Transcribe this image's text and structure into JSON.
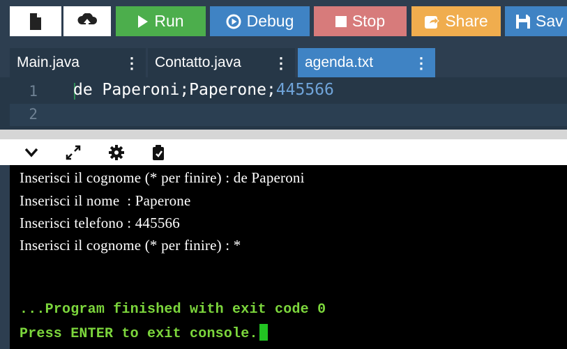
{
  "toolbar": {
    "run_label": "Run",
    "debug_label": "Debug",
    "stop_label": "Stop",
    "share_label": "Share",
    "save_label": "Sav"
  },
  "tabs": [
    {
      "label": "Main.java",
      "active": false
    },
    {
      "label": "Contatto.java",
      "active": false
    },
    {
      "label": "agenda.txt",
      "active": true
    }
  ],
  "editor": {
    "lines": [
      {
        "number": "1",
        "text": "de Paperoni;Paperone;",
        "num_text": "445566"
      },
      {
        "number": "2",
        "text": ""
      }
    ]
  },
  "console": {
    "lines": [
      "Inserisci il cognome (* per finire) : de Paperoni",
      "Inserisci il nome  : Paperone",
      "Inserisci telefono : 445566",
      "Inserisci il cognome (* per finire) : *"
    ],
    "finished": "...Program finished with exit code 0",
    "press_enter": "Press ENTER to exit console."
  },
  "colors": {
    "run": "#4cae4c",
    "debug": "#3f83c4",
    "stop": "#d77b7b",
    "share": "#f0ad4e",
    "console_green": "#7cd63c"
  }
}
